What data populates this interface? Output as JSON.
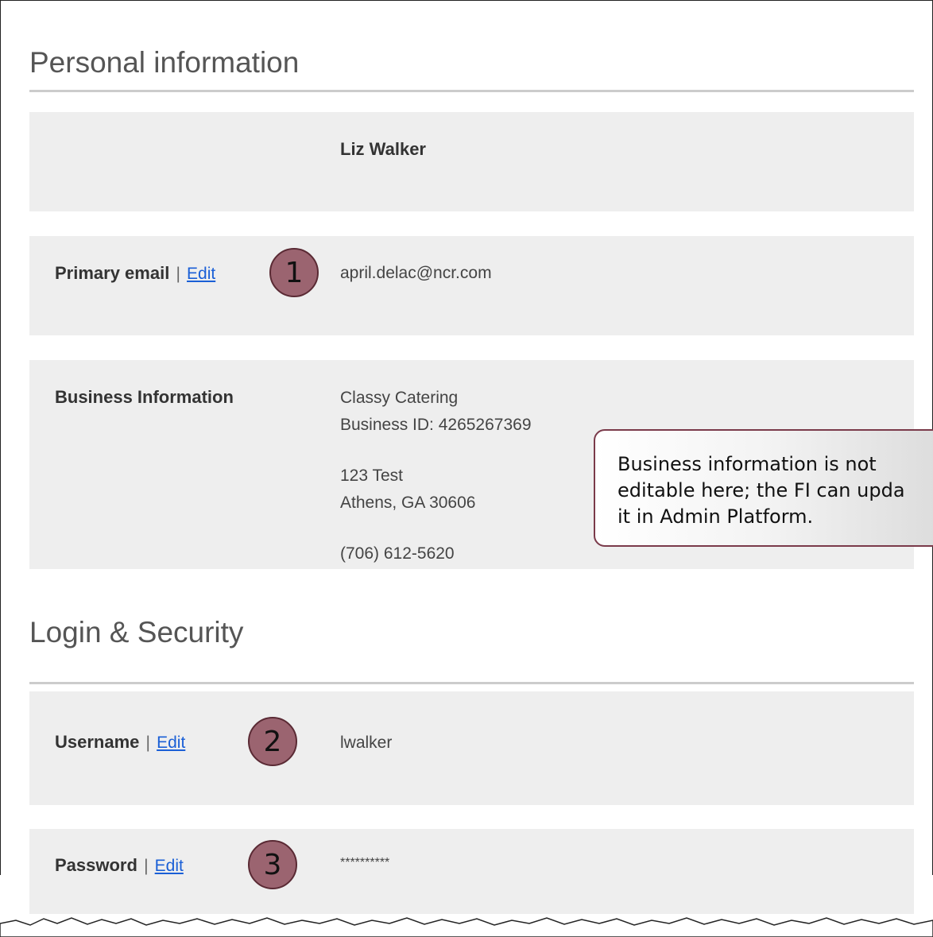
{
  "personal": {
    "title": "Personal information",
    "name": "Liz Walker",
    "email": {
      "label": "Primary email",
      "separator": "|",
      "edit_label": "Edit",
      "value": "april.delac@ncr.com",
      "callout": "1"
    },
    "business": {
      "label": "Business Information",
      "company": "Classy Catering",
      "business_id": "Business ID: 4265267369",
      "address_line1": "123 Test",
      "address_line2": "Athens, GA 30606",
      "phone": "(706) 612-5620"
    }
  },
  "note": {
    "line1": "Business information is not",
    "line2": "editable here; the FI can upda",
    "line3": "it in Admin Platform."
  },
  "login": {
    "title": "Login & Security",
    "username": {
      "label": "Username",
      "separator": "|",
      "edit_label": "Edit",
      "value": "lwalker",
      "callout": "2"
    },
    "password": {
      "label": "Password",
      "separator": "|",
      "edit_label": "Edit",
      "value": "**********",
      "callout": "3"
    }
  },
  "colors": {
    "callout_fill": "#9b6470",
    "link": "#1a5fd6",
    "panel": "#eeeeee"
  }
}
